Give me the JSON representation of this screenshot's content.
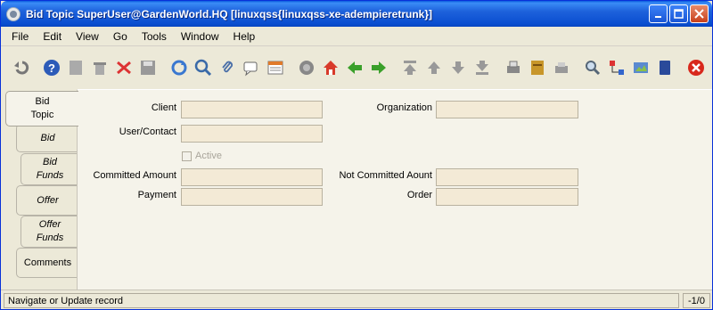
{
  "window": {
    "title": "Bid Topic  SuperUser@GardenWorld.HQ [linuxqss{linuxqss-xe-adempieretrunk}]"
  },
  "menu": [
    {
      "label": "File"
    },
    {
      "label": "Edit"
    },
    {
      "label": "View"
    },
    {
      "label": "Go"
    },
    {
      "label": "Tools"
    },
    {
      "label": "Window"
    },
    {
      "label": "Help"
    }
  ],
  "toolbar": {
    "icons": [
      "undo-icon",
      "help-icon",
      "new-icon",
      "delete-icon",
      "delete-selection-icon",
      "save-icon",
      "refresh-icon",
      "find-icon",
      "attachment-icon",
      "chat-icon",
      "history-icon",
      "home-icon",
      "parent-icon",
      "back-icon",
      "forward-icon",
      "first-record-icon",
      "previous-record-icon",
      "next-record-icon",
      "last-record-icon",
      "report-icon",
      "archive-icon",
      "print-icon",
      "zoom-across-icon",
      "workflow-icon",
      "product-info-icon",
      "request-icon",
      "exit-icon"
    ]
  },
  "tabs": [
    {
      "label": "Bid\nTopic",
      "active": true
    },
    {
      "label": "Bid"
    },
    {
      "label": "Bid\nFunds"
    },
    {
      "label": "Offer"
    },
    {
      "label": "Offer\nFunds"
    },
    {
      "label": "Comments"
    }
  ],
  "form": {
    "client_label": "Client",
    "client_value": "",
    "organization_label": "Organization",
    "organization_value": "",
    "user_contact_label": "User/Contact",
    "user_contact_value": "",
    "active_label": "Active",
    "committed_amount_label": "Committed Amount",
    "committed_amount_value": "",
    "not_committed_label": "Not Committed Aount",
    "not_committed_value": "",
    "payment_label": "Payment",
    "payment_value": "",
    "order_label": "Order",
    "order_value": ""
  },
  "status": {
    "message": "Navigate or Update record",
    "record_count": "-1/0"
  },
  "colors": {
    "title_bar": "#0a5bde",
    "field_background": "#f3ead6",
    "panel_background": "#f5f3ea"
  }
}
